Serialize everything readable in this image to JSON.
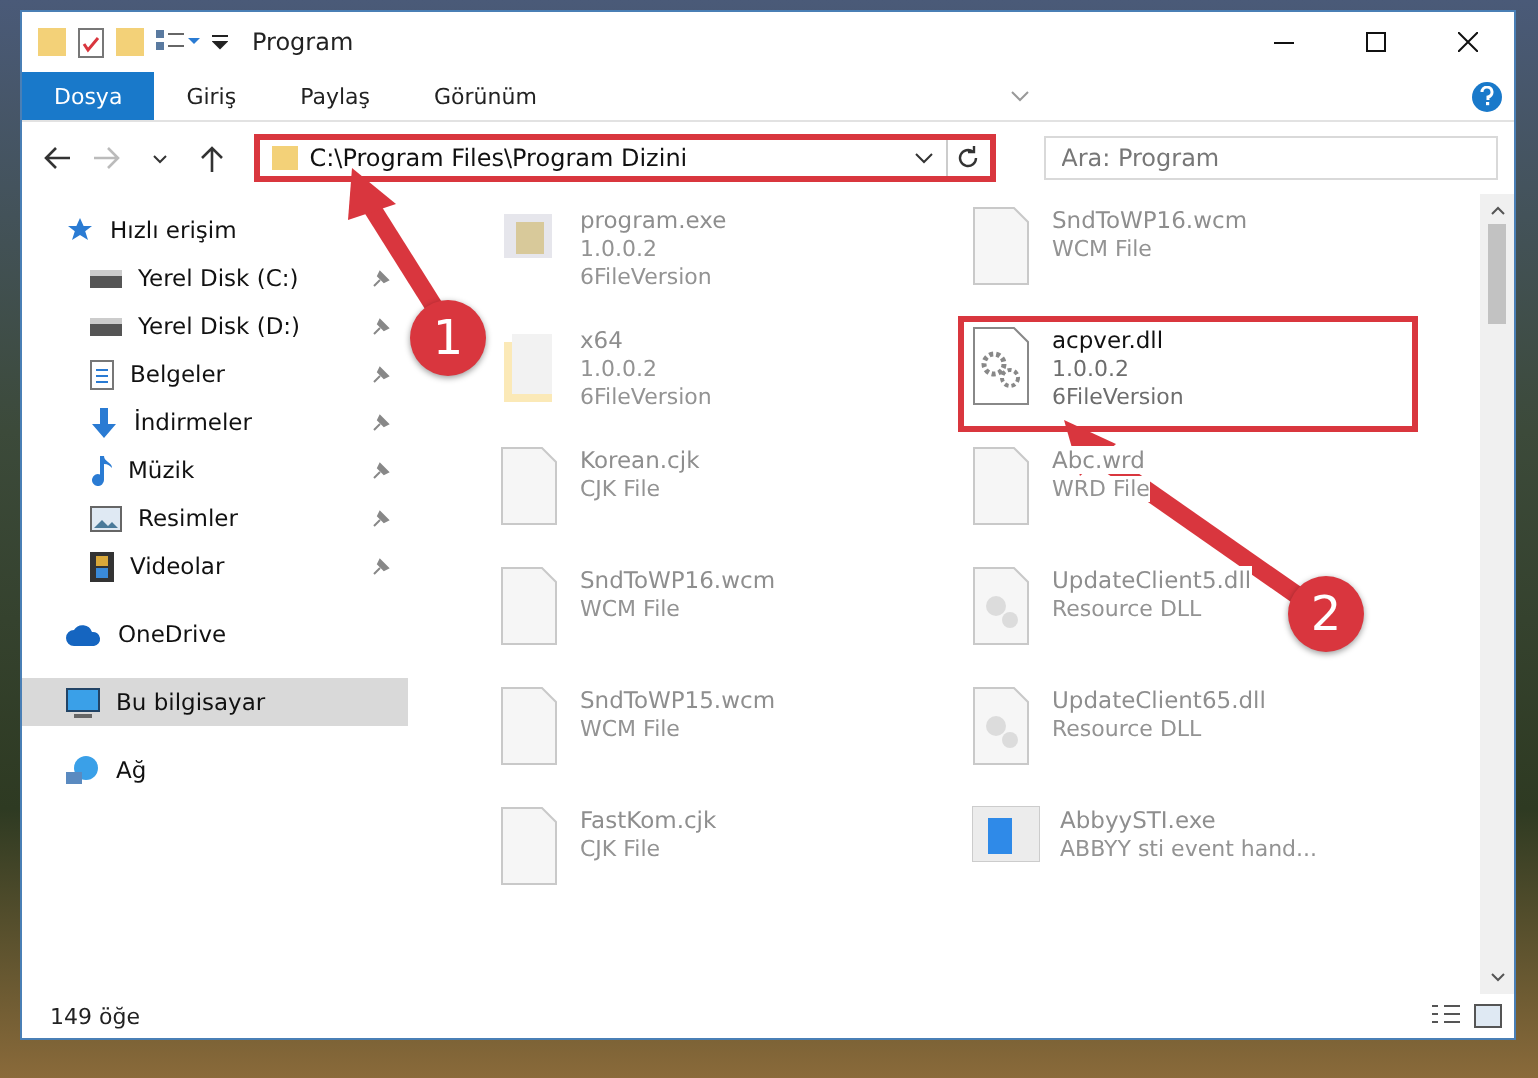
{
  "window": {
    "title": "Program"
  },
  "ribbon_tabs": [
    {
      "label": "Dosya",
      "selected": true
    },
    {
      "label": "Giriş",
      "selected": false
    },
    {
      "label": "Paylaş",
      "selected": false
    },
    {
      "label": "Görünüm",
      "selected": false
    }
  ],
  "address_bar": {
    "path": "C:\\Program Files\\Program Dizini",
    "highlighted": true
  },
  "search": {
    "placeholder": "Ara: Program"
  },
  "nav_items": [
    {
      "label": "Hızlı erişim",
      "kind": "star",
      "pinned": false,
      "selected": false,
      "children": [
        {
          "label": "Yerel Disk (C:)",
          "kind": "drive",
          "pinned": true,
          "selected": false
        },
        {
          "label": "Yerel Disk (D:)",
          "kind": "drive",
          "pinned": true,
          "selected": false
        },
        {
          "label": "Belgeler",
          "kind": "doc",
          "pinned": true,
          "selected": false
        },
        {
          "label": "İndirmeler",
          "kind": "download",
          "pinned": true,
          "selected": false
        },
        {
          "label": "Müzik",
          "kind": "music",
          "pinned": true,
          "selected": false
        },
        {
          "label": "Resimler",
          "kind": "picture",
          "pinned": true,
          "selected": false
        },
        {
          "label": "Videolar",
          "kind": "video",
          "pinned": true,
          "selected": false
        }
      ]
    },
    {
      "label": "OneDrive",
      "kind": "cloud",
      "pinned": false,
      "selected": false
    },
    {
      "label": "Bu bilgisayar",
      "kind": "computer",
      "pinned": false,
      "selected": true
    },
    {
      "label": "Ağ",
      "kind": "network",
      "pinned": false,
      "selected": false
    }
  ],
  "files": [
    {
      "name": "program.exe",
      "details": [
        "1.0.0.2",
        "6FileVersion"
      ],
      "kind": "exe",
      "dimmed": true,
      "highlighted": false
    },
    {
      "name": "SndToWP16.wcm",
      "details": [
        "WCM File"
      ],
      "kind": "blank",
      "dimmed": true,
      "highlighted": false
    },
    {
      "name": "x64",
      "details": [
        "1.0.0.2",
        "6FileVersion"
      ],
      "kind": "folder",
      "dimmed": true,
      "highlighted": false
    },
    {
      "name": "acpver.dll",
      "details": [
        "1.0.0.2",
        "6FileVersion"
      ],
      "kind": "gear",
      "dimmed": false,
      "highlighted": true
    },
    {
      "name": "Korean.cjk",
      "details": [
        "CJK File"
      ],
      "kind": "blank",
      "dimmed": true,
      "highlighted": false
    },
    {
      "name": "Abc.wrd",
      "details": [
        "WRD File"
      ],
      "kind": "blank",
      "dimmed": true,
      "highlighted": false
    },
    {
      "name": "SndToWP16.wcm",
      "details": [
        "WCM File"
      ],
      "kind": "blank",
      "dimmed": true,
      "highlighted": false
    },
    {
      "name": "UpdateClient5.dll",
      "details": [
        "Resource DLL"
      ],
      "kind": "dll",
      "dimmed": true,
      "highlighted": false
    },
    {
      "name": "SndToWP15.wcm",
      "details": [
        "WCM File"
      ],
      "kind": "blank",
      "dimmed": true,
      "highlighted": false
    },
    {
      "name": "UpdateClient65.dll",
      "details": [
        "Resource DLL"
      ],
      "kind": "dll",
      "dimmed": true,
      "highlighted": false
    },
    {
      "name": "FastKom.cjk",
      "details": [
        "CJK File"
      ],
      "kind": "blank",
      "dimmed": true,
      "highlighted": false
    },
    {
      "name": "AbbyySTI.exe",
      "details": [
        "ABBYY sti event hand..."
      ],
      "kind": "app",
      "dimmed": true,
      "highlighted": false
    }
  ],
  "annotations": [
    {
      "label": "1"
    },
    {
      "label": "2"
    }
  ],
  "status_bar": {
    "count": "149 öğe"
  }
}
